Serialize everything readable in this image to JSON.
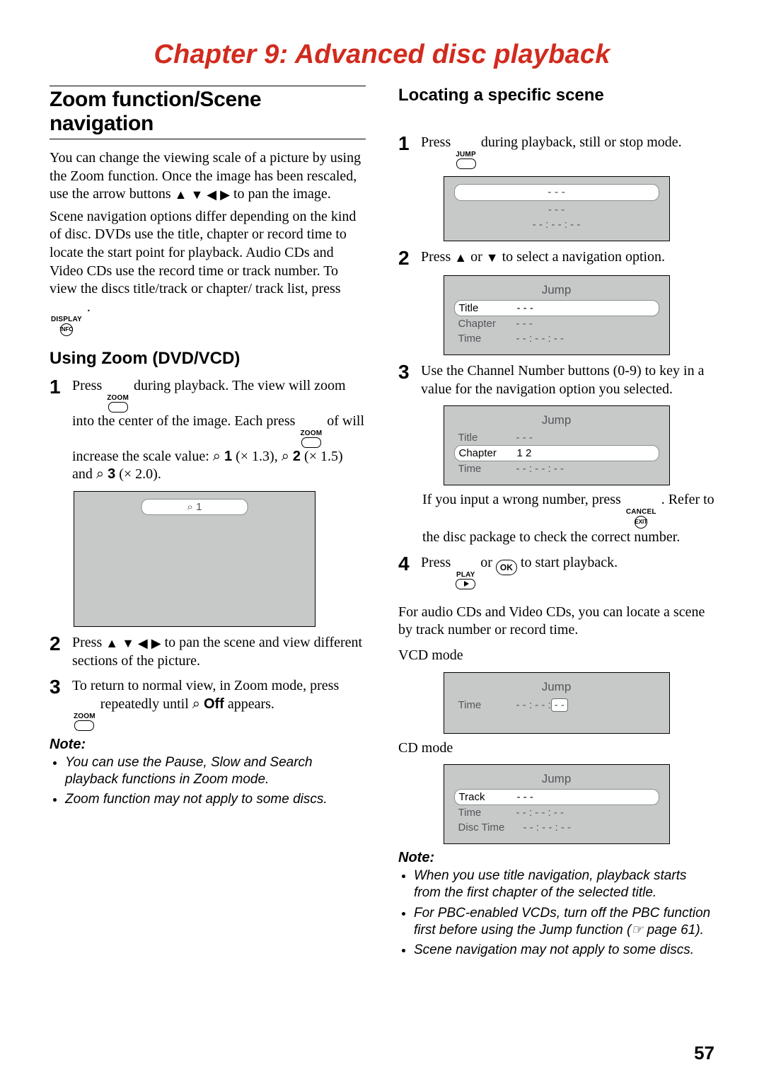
{
  "chapter_title": "Chapter 9: Advanced disc playback",
  "page_number": "57",
  "left": {
    "section_title": "Zoom function/Scene navigation",
    "intro_p1_a": "You can change the viewing scale of a picture by using the Zoom function. Once the image has been rescaled, use the arrow buttons ",
    "intro_p1_b": " to pan the image.",
    "intro_p2_a": "Scene navigation options differ depending on the kind of disc. DVDs use the title, chapter or record time to locate the start point for playback. Audio CDs and Video CDs use the record time or track number. To view the discs title/track or chapter/ track list, press ",
    "intro_p2_b": " .",
    "display_key": "DISPLAY",
    "info_key": "INFO",
    "subsection_title": "Using Zoom (DVD/VCD)",
    "step1_a": "Press ",
    "step1_b": " during playback. The view will zoom into the center of the image. Each press ",
    "step1_c": " of will increase the scale value: ",
    "step1_d1": " (× 1.3), ",
    "step1_d2": " (× 1.5) and ",
    "step1_d3": " (× 2.0).",
    "zoom_key": "ZOOM",
    "zoom_glyph": "⌕",
    "zoom_levels": {
      "l1": "1",
      "l2": "2",
      "l3": "3"
    },
    "osd_zoom_label": "⌕ 1",
    "step2_a": "Press ",
    "step2_b": " to pan the scene and view different sections of the picture.",
    "step3_a": "To return to normal view, in Zoom mode, press ",
    "step3_b": " repeatedly until ",
    "step3_off": "Off",
    "step3_c": " appears.",
    "note_hdr": "Note:",
    "notes": [
      "You can use the Pause, Slow and Search playback functions in Zoom mode.",
      "Zoom function may not apply to some discs."
    ]
  },
  "right": {
    "subsection_title": "Locating a specific scene",
    "step1_a": "Press ",
    "step1_b": " during playback, still or stop mode.",
    "jump_key": "JUMP",
    "osd1": {
      "row1": "- - -",
      "row2": "- - -",
      "row3": "- -   :   - -   :   - -"
    },
    "step2_a": "Press ",
    "step2_b": " or ",
    "step2_c": " to select a navigation option.",
    "osd2": {
      "header": "Jump",
      "rows": [
        {
          "label": "Title",
          "value": "- - -",
          "selected": true
        },
        {
          "label": "Chapter",
          "value": "- - -"
        },
        {
          "label": "Time",
          "value": "- -   :   - -   :   - -"
        }
      ]
    },
    "step3": "Use the Channel Number buttons (0-9) to key in a value for the navigation option you selected.",
    "osd3": {
      "header": "Jump",
      "rows": [
        {
          "label": "Title",
          "value": "- - -"
        },
        {
          "label": "Chapter",
          "value": "1 2",
          "selected": true
        },
        {
          "label": "Time",
          "value": "- -   :   - -   :   - -"
        }
      ]
    },
    "wrong_a": "If you input a wrong number, press ",
    "wrong_b": " . Refer to the disc package to check the correct number.",
    "cancel_key": "CANCEL",
    "exit_key": "EXIT",
    "step4_a": "Press ",
    "step4_b": " or ",
    "step4_c": " to start playback.",
    "play_key": "PLAY",
    "ok_key": "OK",
    "cd_intro": "For audio CDs and Video CDs, you can locate a scene by track number or record time.",
    "vcd_label": "VCD mode",
    "osd_vcd": {
      "header": "Jump",
      "row_label": "Time",
      "value_a": "- -   :   - -   : ",
      "value_b": "- -"
    },
    "cd_label": "CD mode",
    "osd_cd": {
      "header": "Jump",
      "rows": [
        {
          "label": "Track",
          "value": "- - -",
          "selected": true
        },
        {
          "label": "Time",
          "value": "- -   :   - -   :   - -"
        },
        {
          "label": "Disc Time",
          "value": "- -   :   - -   :   - -"
        }
      ]
    },
    "note_hdr": "Note:",
    "notes": [
      "When you use title navigation, playback starts from the first chapter of the selected title.",
      "For PBC-enabled VCDs, turn off the PBC function first before using the Jump function (☞ page 61).",
      "Scene navigation may not apply to some discs."
    ]
  },
  "arrows": {
    "up": "▲",
    "down": "▼",
    "left": "◀",
    "right": "▶"
  }
}
